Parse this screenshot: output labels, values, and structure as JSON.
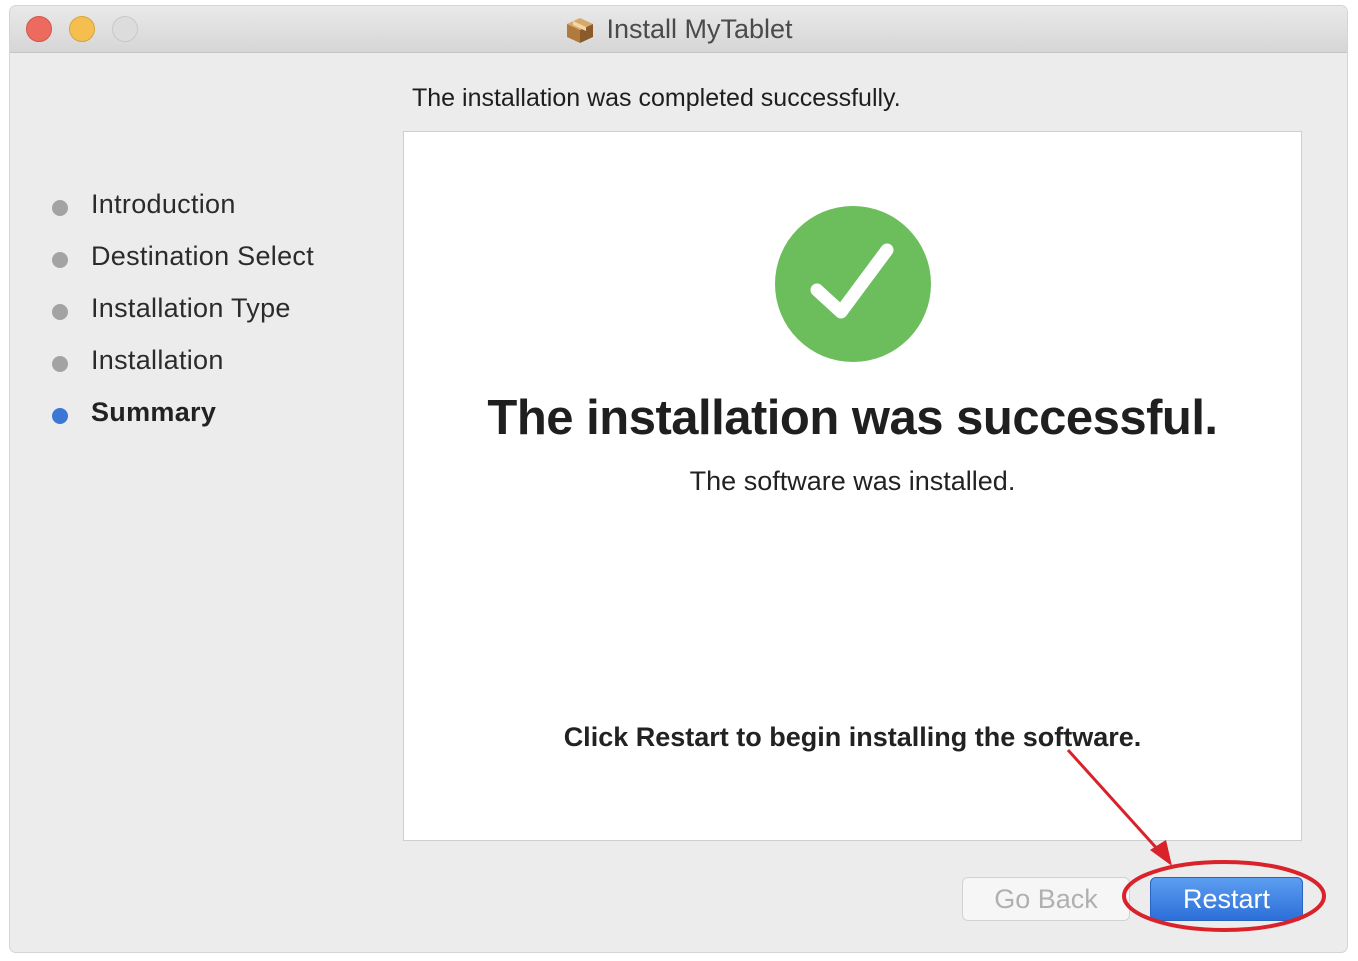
{
  "window": {
    "title": "Install MyTablet"
  },
  "header": {
    "subtitle": "The installation was completed successfully."
  },
  "sidebar": {
    "items": [
      {
        "label": "Introduction",
        "active": false
      },
      {
        "label": "Destination Select",
        "active": false
      },
      {
        "label": "Installation Type",
        "active": false
      },
      {
        "label": "Installation",
        "active": false
      },
      {
        "label": "Summary",
        "active": true
      }
    ]
  },
  "content": {
    "heading": "The installation was successful.",
    "subheading": "The software was installed.",
    "hint": "Click Restart to begin installing the software.",
    "status_icon": "checkmark-circle-icon"
  },
  "buttons": {
    "back_label": "Go Back",
    "back_enabled": false,
    "restart_label": "Restart"
  },
  "colors": {
    "success_green": "#6cbd5c",
    "accent_blue": "#3b78d5",
    "annotation_red": "#d9222a"
  }
}
